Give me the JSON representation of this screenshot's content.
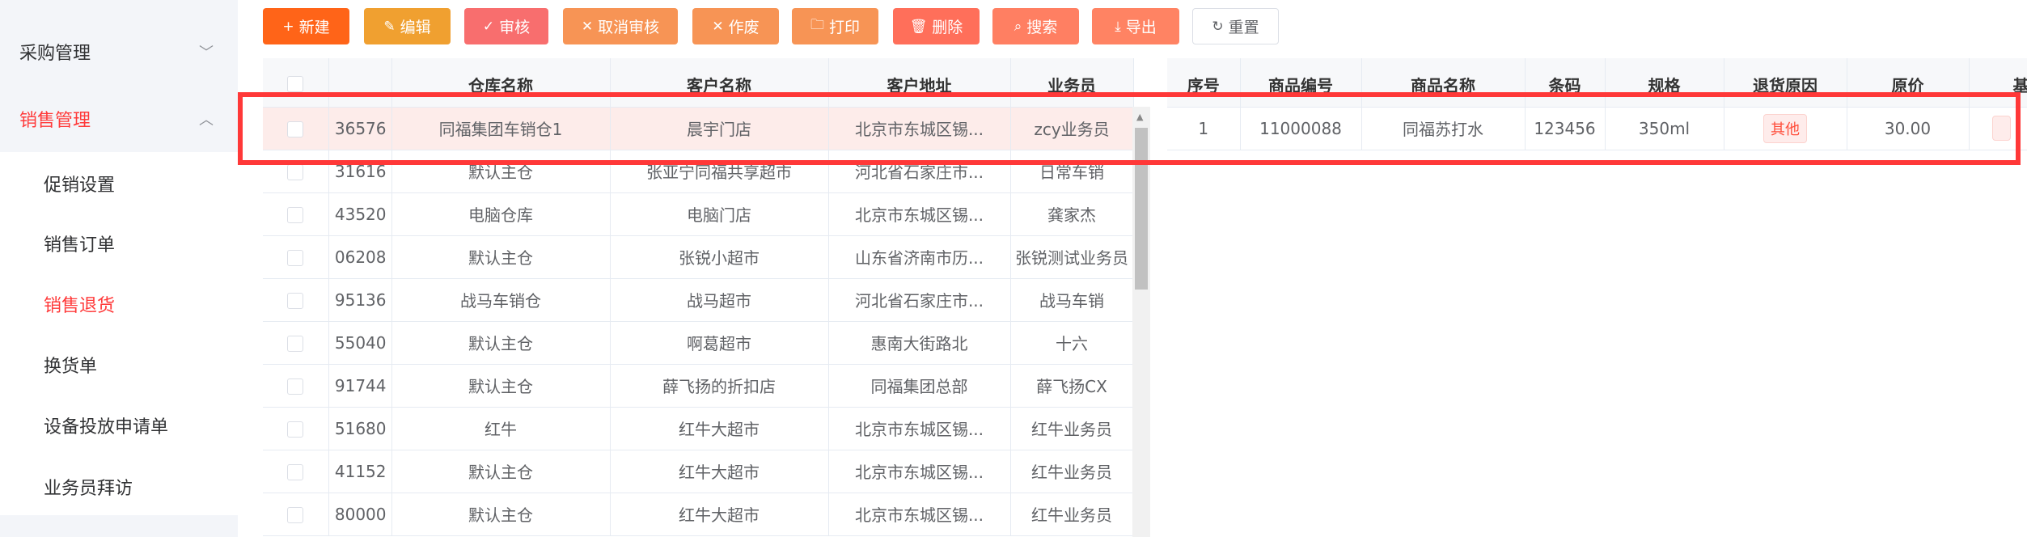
{
  "sidebar": {
    "groups": [
      {
        "label": "采购管理",
        "expanded": false
      },
      {
        "label": "销售管理",
        "expanded": true
      }
    ],
    "items": [
      {
        "label": "促销设置"
      },
      {
        "label": "销售订单"
      },
      {
        "label": "销售退货",
        "active": true
      },
      {
        "label": "换货单"
      },
      {
        "label": "设备投放申请单"
      },
      {
        "label": "业务员拜访"
      }
    ]
  },
  "toolbar": [
    {
      "label": "新建",
      "icon": "plus-icon",
      "glyph": "+",
      "color": "#ff6418"
    },
    {
      "label": "编辑",
      "icon": "edit-icon",
      "glyph": "✎",
      "color": "#f0a030"
    },
    {
      "label": "审核",
      "icon": "check-icon",
      "glyph": "✓",
      "color": "#f86e6e"
    },
    {
      "label": "取消审核",
      "icon": "close-icon",
      "glyph": "✕",
      "color": "#f79455"
    },
    {
      "label": "作废",
      "icon": "close-icon",
      "glyph": "✕",
      "color": "#f79455"
    },
    {
      "label": "打印",
      "icon": "folder-icon",
      "glyph": "🗀",
      "color": "#f79455"
    },
    {
      "label": "删除",
      "icon": "trash-icon",
      "glyph": "🗑",
      "color": "#ff6f5a"
    },
    {
      "label": "搜索",
      "icon": "search-icon",
      "glyph": "⌕",
      "color": "#ff7f62"
    },
    {
      "label": "导出",
      "icon": "download-icon",
      "glyph": "⤓",
      "color": "#ff8363"
    },
    {
      "label": "重置",
      "icon": "refresh-icon",
      "glyph": "↻",
      "color": "#ffffff"
    }
  ],
  "main_table": {
    "headers": [
      "",
      "",
      "仓库名称",
      "客户名称",
      "客户地址",
      "业务员"
    ],
    "rows": [
      [
        "36576",
        "同福集团车销仓1",
        "晨宇门店",
        "北京市东城区锡...",
        "zcy业务员"
      ],
      [
        "31616",
        "默认主仓",
        "张亚宁同福共享超市",
        "河北省石家庄市...",
        "日常车销"
      ],
      [
        "43520",
        "电脑仓库",
        "电脑门店",
        "北京市东城区锡...",
        "龚家杰"
      ],
      [
        "06208",
        "默认主仓",
        "张锐小超市",
        "山东省济南市历...",
        "张锐测试业务员"
      ],
      [
        "95136",
        "战马车销仓",
        "战马超市",
        "河北省石家庄市...",
        "战马车销"
      ],
      [
        "55040",
        "默认主仓",
        "啊葛超市",
        "惠南大街路北",
        "十六"
      ],
      [
        "91744",
        "默认主仓",
        "薛飞扬的折扣店",
        "同福集团总部",
        "薛飞扬CX"
      ],
      [
        "51680",
        "红牛",
        "红牛大超市",
        "北京市东城区锡...",
        "红牛业务员"
      ],
      [
        "41152",
        "默认主仓",
        "红牛大超市",
        "北京市东城区锡...",
        "红牛业务员"
      ],
      [
        "80000",
        "默认主仓",
        "红牛大超市",
        "北京市东城区锡...",
        "红牛业务员"
      ]
    ]
  },
  "detail_table": {
    "headers": [
      "序号",
      "商品编号",
      "商品名称",
      "条码",
      "规格",
      "退货原因",
      "原价",
      "基本"
    ],
    "rows": [
      [
        "1",
        "11000088",
        "同福苏打水",
        "123456",
        "350ml",
        "其他",
        "30.00",
        ""
      ]
    ]
  },
  "colors": {
    "accent": "#ff3a3a",
    "selected_row": "#fdecea",
    "annotation": "#ff3838"
  }
}
